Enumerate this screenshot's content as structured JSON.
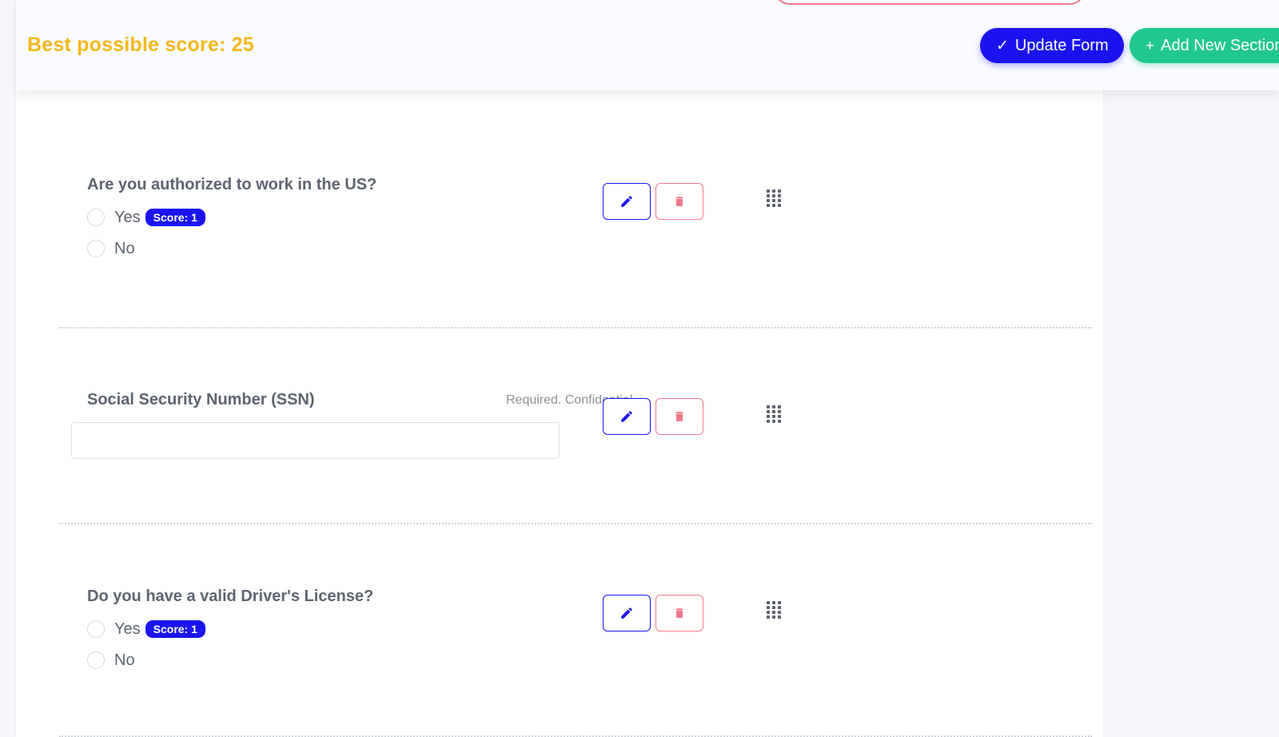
{
  "header": {
    "best_score": "Best possible score: 25",
    "update_label": "Update Form",
    "add_label": "Add New Section",
    "colors": {
      "score_text": "#f6b71d",
      "update_button": "#1a13f0",
      "add_button": "#21c790"
    }
  },
  "questions": [
    {
      "title": "Are you authorized to work in the US?",
      "type": "radio",
      "options": [
        {
          "label": "Yes",
          "score": "Score: 1"
        },
        {
          "label": "No"
        }
      ]
    },
    {
      "title": "Social Security Number (SSN)",
      "type": "text",
      "note": "Required. Confidential.",
      "value": ""
    },
    {
      "title": "Do you have a valid Driver's License?",
      "type": "radio",
      "options": [
        {
          "label": "Yes",
          "score": "Score: 1"
        },
        {
          "label": "No"
        }
      ]
    }
  ],
  "icons": {
    "edit": "pencil-icon",
    "delete": "trash-icon",
    "drag": "drag-handle-icon",
    "update": "check-icon",
    "add": "plus-icon"
  },
  "colors": {
    "edit_border": "#1a13f0",
    "delete_border": "#f0788a",
    "text": "#5d6470"
  }
}
